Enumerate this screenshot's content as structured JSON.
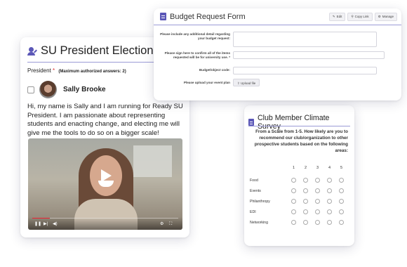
{
  "budget_form": {
    "title": "Budget Request Form",
    "toolbar": [
      {
        "icon": "pencil-icon",
        "glyph": "✎",
        "label": "Edit"
      },
      {
        "icon": "link-icon",
        "glyph": "⚲",
        "label": "Copy Link"
      },
      {
        "icon": "gear-icon",
        "glyph": "⚙",
        "label": "Manage"
      }
    ],
    "fields": [
      {
        "label": "Please include any additional detail regarding your budget request:",
        "value": ""
      },
      {
        "label": "Please sign here to confirm all of the items requested will be for university use. *",
        "value": ""
      },
      {
        "label": "Budget/object code:",
        "value": ""
      },
      {
        "label": "Please upload your event plan",
        "button": "Upload file"
      }
    ]
  },
  "election": {
    "title": "SU President Election",
    "question": "President",
    "required_mark": "*",
    "note": "(Maximum authorized answers: 2)",
    "candidate": "Sally Brooke",
    "bio": "Hi, my name is Sally and I am running for Ready SU President. I am passionate about representing students and enacting change, and electing me will give me the tools to do so on a bigger scale!",
    "video_progress": 0.12
  },
  "survey": {
    "title": "Club Member Climate Survey",
    "question": "From a Scale from 1-5. How likely are you to recommend our club/organization to other prospective students based on the following areas:",
    "scale": [
      "1",
      "2",
      "3",
      "4",
      "5"
    ],
    "rows": [
      "Food",
      "Events",
      "Philanthropy",
      "EDI",
      "Networking"
    ]
  },
  "colors": {
    "accent": "#5b57b7",
    "divider": "#9b9bd6",
    "required": "#dd3333"
  }
}
